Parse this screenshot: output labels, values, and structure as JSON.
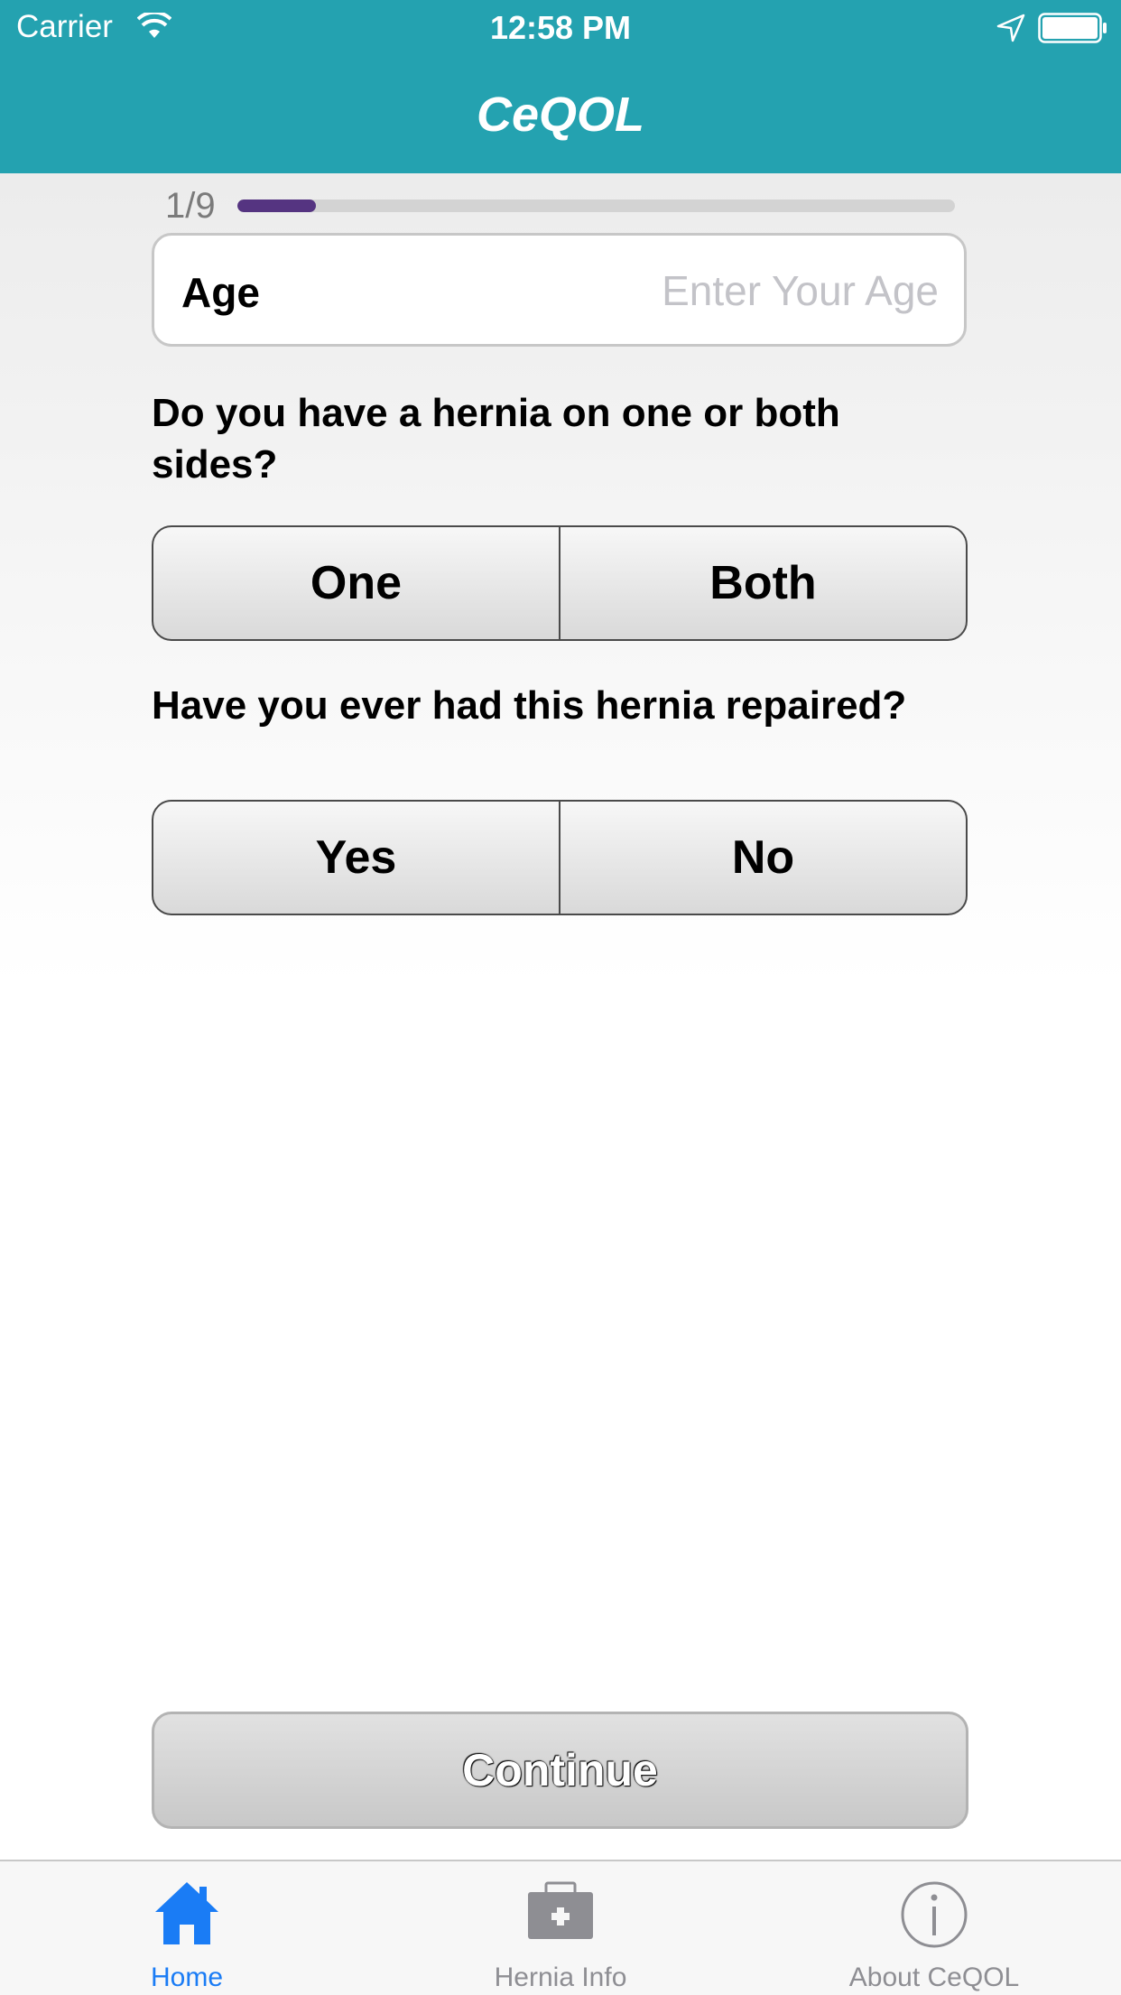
{
  "status_bar": {
    "carrier": "Carrier",
    "time": "12:58 PM"
  },
  "nav": {
    "title": "CeQOL"
  },
  "progress": {
    "label": "1/9",
    "fraction": 0.11
  },
  "age_field": {
    "label": "Age",
    "placeholder": "Enter Your Age",
    "value": ""
  },
  "questions": [
    {
      "text": "Do you have a hernia on one or both sides?",
      "options": [
        "One",
        "Both"
      ]
    },
    {
      "text": "Have you ever had this hernia repaired?",
      "options": [
        "Yes",
        "No"
      ]
    }
  ],
  "continue_label": "Continue",
  "tabs": [
    {
      "label": "Home",
      "icon": "house-icon",
      "selected": true
    },
    {
      "label": "Hernia Info",
      "icon": "medical-kit-icon",
      "selected": false
    },
    {
      "label": "About CeQOL",
      "icon": "info-icon",
      "selected": false
    }
  ],
  "colors": {
    "header": "#24a2b0",
    "progress_fill": "#553481",
    "progress_track": "#d3d3d3",
    "tab_selected": "#1a7cf5",
    "tab_unselected": "#8e8e93"
  }
}
